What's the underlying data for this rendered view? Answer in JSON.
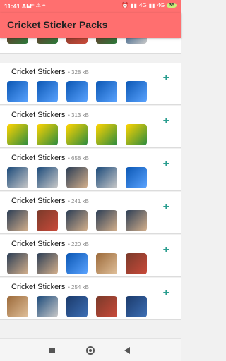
{
  "status_bar": {
    "time": "11:41 AM",
    "left_icons": [
      "chat-icon",
      "warning-icon",
      "map-icon"
    ],
    "right_text": "4G",
    "right_text_2": "4G",
    "battery": "35"
  },
  "app_bar": {
    "title": "Cricket Sticker Packs"
  },
  "packs": [
    {
      "name": "",
      "meta": "",
      "add": "+",
      "thumbs": [
        "c7",
        "c7",
        "c5",
        "c7",
        "c4"
      ]
    },
    {
      "name": "Cricket Stickers",
      "meta": "• 328 kB",
      "add": "+",
      "thumbs": [
        "c2",
        "c2",
        "c2",
        "c2",
        "c2"
      ]
    },
    {
      "name": "Cricket Stickers",
      "meta": "• 313 kB",
      "add": "+",
      "thumbs": [
        "c3",
        "c3",
        "c3",
        "c3",
        "c3"
      ]
    },
    {
      "name": "Cricket Stickers",
      "meta": "• 658 kB",
      "add": "+",
      "thumbs": [
        "c4",
        "c4",
        "c6",
        "c4",
        "c2"
      ]
    },
    {
      "name": "Cricket Stickers",
      "meta": "• 241 kB",
      "add": "+",
      "thumbs": [
        "c6",
        "c5",
        "c6",
        "c6",
        "c6"
      ]
    },
    {
      "name": "Cricket Stickers",
      "meta": "• 220 kB",
      "add": "+",
      "thumbs": [
        "c6",
        "c6",
        "c2",
        "c8",
        "c5"
      ]
    },
    {
      "name": "Cricket Stickers",
      "meta": "• 254 kB",
      "add": "+",
      "thumbs": [
        "c8",
        "c4",
        "c1",
        "c5",
        "c1"
      ]
    }
  ],
  "nav_bar": {
    "icons": [
      "recents-square-icon",
      "home-circle-icon",
      "back-triangle-icon"
    ]
  }
}
